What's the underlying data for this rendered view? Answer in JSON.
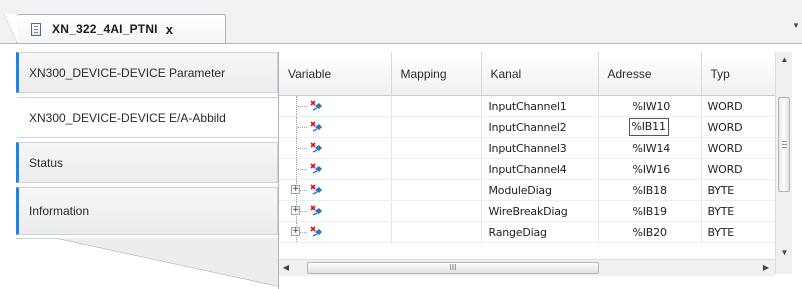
{
  "editor_tab": {
    "title": "XN_322_4AI_PTNI",
    "close_glyph": "x",
    "icon": "document-icon"
  },
  "nav": {
    "items": [
      {
        "label": "XN300_DEVICE-DEVICE Parameter",
        "selected": false
      },
      {
        "label": "XN300_DEVICE-DEVICE E/A-Abbild",
        "selected": true
      },
      {
        "label": "Status",
        "selected": false
      },
      {
        "label": "Information",
        "selected": false
      }
    ],
    "accent_color": "#2e7fd8"
  },
  "grid": {
    "columns": [
      "Variable",
      "Mapping",
      "Kanal",
      "Adresse",
      "Typ"
    ],
    "rows": [
      {
        "variable": "",
        "mapping": "",
        "kanal": "InputChannel1",
        "adresse": "%IW10",
        "typ": "WORD",
        "expandable": false,
        "editing": false
      },
      {
        "variable": "",
        "mapping": "",
        "kanal": "InputChannel2",
        "adresse": "%IB11",
        "typ": "WORD",
        "expandable": false,
        "editing": true
      },
      {
        "variable": "",
        "mapping": "",
        "kanal": "InputChannel3",
        "adresse": "%IW14",
        "typ": "WORD",
        "expandable": false,
        "editing": false
      },
      {
        "variable": "",
        "mapping": "",
        "kanal": "InputChannel4",
        "adresse": "%IW16",
        "typ": "WORD",
        "expandable": false,
        "editing": false
      },
      {
        "variable": "",
        "mapping": "",
        "kanal": "ModuleDiag",
        "adresse": "%IB18",
        "typ": "BYTE",
        "expandable": true,
        "editing": false
      },
      {
        "variable": "",
        "mapping": "",
        "kanal": "WireBreakDiag",
        "adresse": "%IB19",
        "typ": "BYTE",
        "expandable": true,
        "editing": false
      },
      {
        "variable": "",
        "mapping": "",
        "kanal": "RangeDiag",
        "adresse": "%IB20",
        "typ": "BYTE",
        "expandable": true,
        "editing": false
      }
    ],
    "row_icon": "io-channel-icon",
    "hscroll_grip": "III"
  }
}
